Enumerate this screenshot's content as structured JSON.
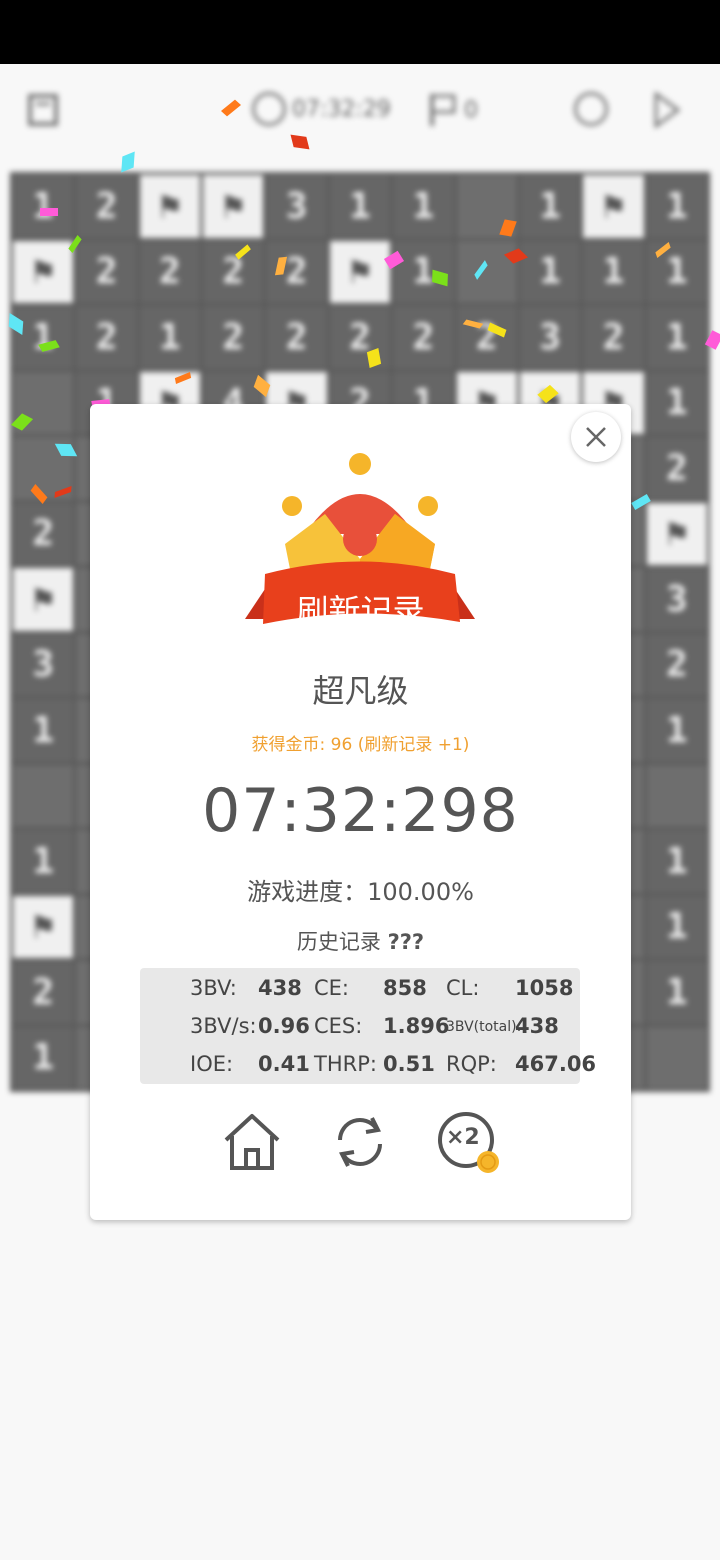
{
  "game": {
    "top_time": "07:32:29",
    "top_flags": "0",
    "board": [
      [
        "1",
        "2",
        "F",
        "F",
        "3",
        "1",
        "1",
        "",
        "1",
        "F",
        "1"
      ],
      [
        "F",
        "2",
        "2",
        "2",
        "2",
        "F",
        "1",
        "",
        "1",
        "1",
        "1"
      ],
      [
        "1",
        "2",
        "1",
        "2",
        "2",
        "2",
        "2",
        "2",
        "3",
        "2",
        "1"
      ],
      [
        "",
        "1",
        "F",
        "4",
        "F",
        "2",
        "1",
        "F",
        "F",
        "F",
        "1"
      ],
      [
        "",
        "",
        "",
        "",
        "",
        "",
        "",
        "",
        "",
        "",
        "2"
      ],
      [
        "2",
        "",
        "",
        "",
        "",
        "",
        "",
        "",
        "",
        "",
        "F"
      ],
      [
        "F",
        "",
        "",
        "",
        "",
        "",
        "",
        "",
        "",
        "",
        "3"
      ],
      [
        "3",
        "",
        "",
        "",
        "",
        "",
        "",
        "",
        "",
        "",
        "2"
      ],
      [
        "1",
        "",
        "",
        "",
        "",
        "",
        "",
        "",
        "",
        "",
        "1"
      ],
      [
        "",
        "",
        "",
        "",
        "",
        "",
        "",
        "",
        "",
        "",
        ""
      ],
      [
        "1",
        "",
        "",
        "",
        "",
        "",
        "",
        "",
        "",
        "",
        "1"
      ],
      [
        "F",
        "",
        "",
        "",
        "",
        "",
        "",
        "",
        "",
        "",
        "1"
      ],
      [
        "2",
        "",
        "",
        "",
        "",
        "",
        "",
        "",
        "",
        "",
        "1"
      ],
      [
        "1",
        "",
        "",
        "",
        "",
        "",
        "",
        "",
        "",
        "",
        ""
      ]
    ]
  },
  "dialog": {
    "banner": "刷新记录",
    "rank": "超凡级",
    "coins_text": "获得金币: 96 (刷新记录 +1)",
    "time": "07:32:298",
    "progress_label": "游戏进度：",
    "progress_value": "100.00%",
    "progress_fraction": 1.0,
    "history_label": "历史记录 ",
    "history_value": "???",
    "stats": {
      "r1": {
        "l1": "3BV:",
        "v1": "438",
        "l2": "CE:",
        "v2": "858",
        "l3": "CL:",
        "v3": "1058"
      },
      "r2": {
        "l1": "3BV/s:",
        "v1": "0.96",
        "l2": "CES:",
        "v2": "1.896",
        "l3": "3BV(total):",
        "v3": "438"
      },
      "r3": {
        "l1": "IOE:",
        "v1": "0.41",
        "l2": "THRP:",
        "v2": "0.51",
        "l3": "RQP:",
        "v3": "467.06"
      }
    },
    "actions": {
      "home": "home-icon",
      "restart": "restart-icon",
      "double": "×2"
    }
  },
  "colors": {
    "banner": "#e8401c",
    "crown": "#f7a823",
    "coins": "#f0a030"
  }
}
